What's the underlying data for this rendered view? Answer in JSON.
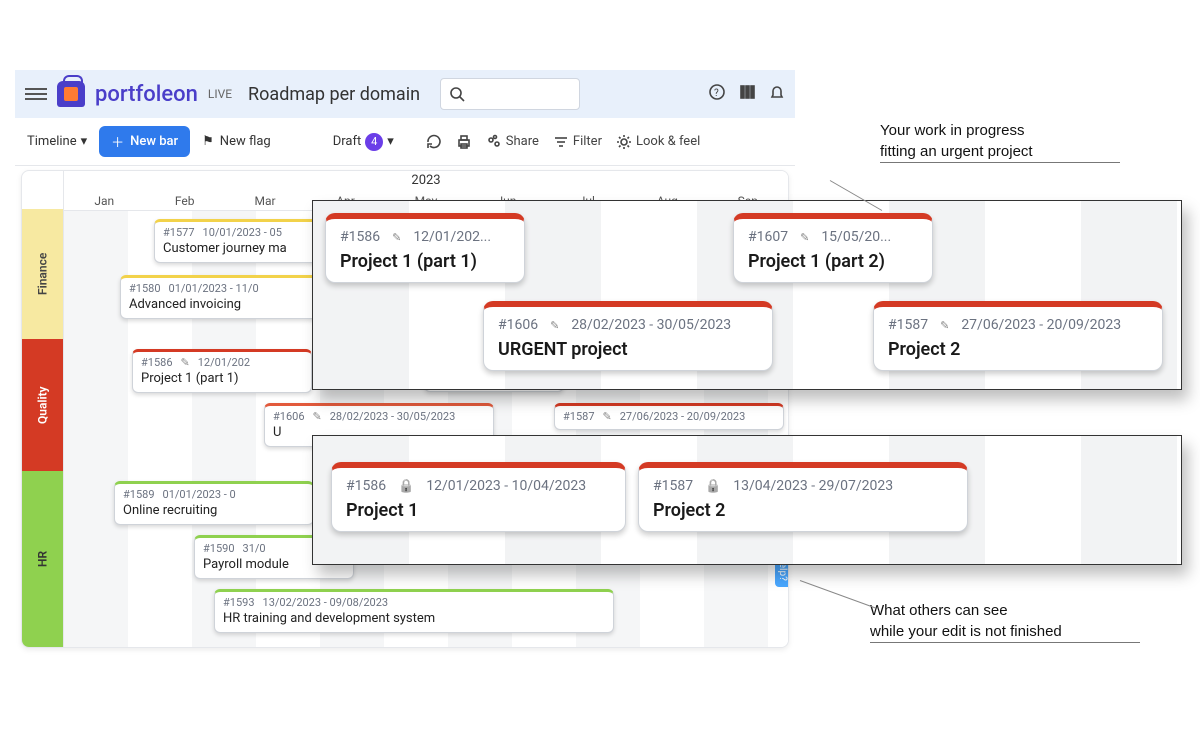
{
  "header": {
    "brand": "portfoleon",
    "env": "LIVE",
    "doc_title": "Roadmap per domain"
  },
  "toolbar": {
    "view": "Timeline",
    "new_bar": "New bar",
    "new_flag": "New flag",
    "draft_label": "Draft",
    "draft_count": "4",
    "share": "Share",
    "filter": "Filter",
    "look_feel": "Look & feel"
  },
  "timeline": {
    "year": "2023",
    "months": [
      "Jan",
      "Feb",
      "Mar",
      "Apr",
      "May",
      "Jun",
      "Jul",
      "Aug",
      "Sep"
    ],
    "help_tab": "Can we help?"
  },
  "lanes": {
    "finance": {
      "label": "Finance",
      "bars": [
        {
          "id": "#1577",
          "dates": "10/01/2023 - 05",
          "title": "Customer journey ma"
        },
        {
          "id": "#1580",
          "dates": "01/01/2023 - 11/0",
          "title": "Advanced invoicing"
        }
      ]
    },
    "quality": {
      "label": "Quality",
      "bars": [
        {
          "id": "#1586",
          "dates": "12/01/202",
          "title": "Project 1 (part 1)",
          "edited": true
        },
        {
          "id_b": "",
          "title_b": "Project 1 (part 2)"
        },
        {
          "id": "#1606",
          "dates": "28/02/2023 - 30/05/2023",
          "title": "U",
          "edited": true
        },
        {
          "id": "#1587",
          "dates": "27/06/2023 - 20/09/2023",
          "title": "",
          "edited": true
        }
      ]
    },
    "hr": {
      "label": "HR",
      "bars": [
        {
          "id": "#1589",
          "dates": "01/01/2023 - 0",
          "title": "Online recruiting"
        },
        {
          "id": "#1590",
          "dates": "31/0",
          "title": "Payroll module"
        },
        {
          "id": "#1593",
          "dates": "13/02/2023 - 09/08/2023",
          "title": "HR training and development system"
        }
      ]
    }
  },
  "overlay_a": {
    "annotation": "Your work in progress\nfitting an urgent project",
    "cards": [
      {
        "id": "#1586",
        "dates": "12/01/202...",
        "title": "Project 1 (part 1)",
        "edited": true
      },
      {
        "id": "#1607",
        "dates": "15/05/20...",
        "title": "Project 1 (part 2)",
        "edited": true
      },
      {
        "id": "#1606",
        "dates": "28/02/2023 - 30/05/2023",
        "title": "URGENT project",
        "edited": true
      },
      {
        "id": "#1587",
        "dates": "27/06/2023 - 20/09/2023",
        "title": "Project 2",
        "edited": true
      }
    ]
  },
  "overlay_b": {
    "annotation": "What others can see\nwhile your edit is not finished",
    "cards": [
      {
        "id": "#1586",
        "dates": "12/01/2023 - 10/04/2023",
        "title": "Project 1",
        "locked": true
      },
      {
        "id": "#1587",
        "dates": "13/04/2023 - 29/07/2023",
        "title": "Project 2",
        "locked": true
      }
    ]
  }
}
